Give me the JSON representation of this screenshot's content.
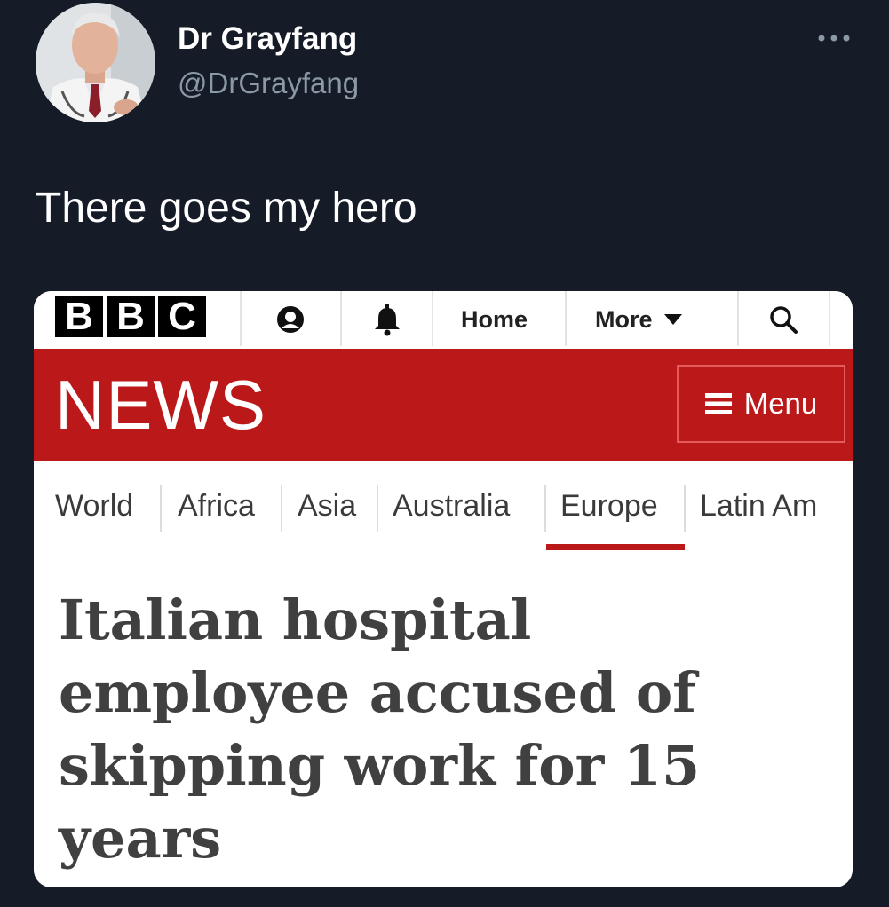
{
  "tweet": {
    "display_name": "Dr Grayfang",
    "handle": "@DrGrayfang",
    "text": "There goes my hero",
    "more_icon": "ellipsis-icon"
  },
  "bbc": {
    "logo_letters": [
      "B",
      "B",
      "C"
    ],
    "bar": {
      "account_icon": "account-icon",
      "notifications_icon": "bell-icon",
      "home_label": "Home",
      "more_label": "More",
      "search_icon": "search-icon"
    },
    "news_wordmark": "NEWS",
    "menu_label": "Menu",
    "regions": [
      "World",
      "Africa",
      "Asia",
      "Australia",
      "Europe",
      "Latin Am"
    ],
    "active_region": "Europe",
    "headline": "Italian hospital employee accused of skipping work for 15 years",
    "colors": {
      "news_red": "#bb1919",
      "background": "#151c27"
    }
  }
}
